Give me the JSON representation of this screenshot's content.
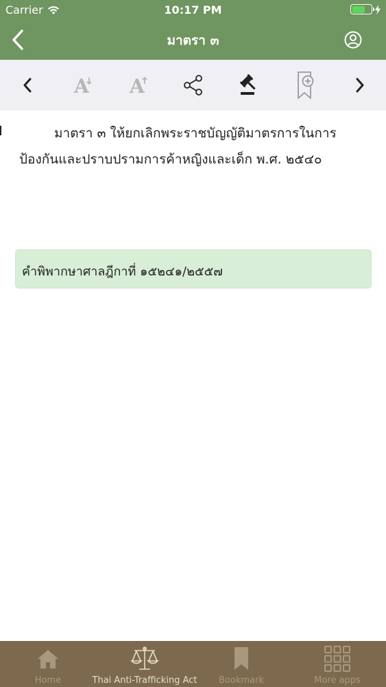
{
  "status_bar": {
    "carrier": "Carrier",
    "time": "10:17 PM",
    "battery_level": 0.7
  },
  "nav": {
    "title": "มาตรา ๓",
    "back_icon": "chevron-left-icon",
    "profile_icon": "user-circle-icon"
  },
  "toolbar": {
    "items": [
      "previous-icon",
      "font-decrease-icon",
      "font-increase-icon",
      "share-icon",
      "gavel-icon",
      "bookmark-add-icon",
      "next-icon"
    ]
  },
  "content": {
    "law_text": "มาตรา ๓ ให้ยกเลิกพระราชบัญญัติมาตรการในการป้องกันและปราบปรามการค้าหญิงและเด็ก พ.ศ. ๒๕๔๐",
    "ruling": "คำพิพากษาศาลฎีกาที่ ๑๕๒๔๑/๒๕๕๗"
  },
  "tab_bar": {
    "items": [
      {
        "label": "Home",
        "icon": "home-icon",
        "active": false
      },
      {
        "label": "Thai Anti-Trafficking Act",
        "icon": "scales-icon",
        "active": true
      },
      {
        "label": "Bookmark",
        "icon": "bookmark-icon",
        "active": false
      },
      {
        "label": "More apps",
        "icon": "grid-icon",
        "active": false
      }
    ]
  },
  "colors": {
    "header_green": "#6f9560",
    "tab_brown": "#7d6a4e",
    "ruling_bg": "#d8eed6"
  }
}
